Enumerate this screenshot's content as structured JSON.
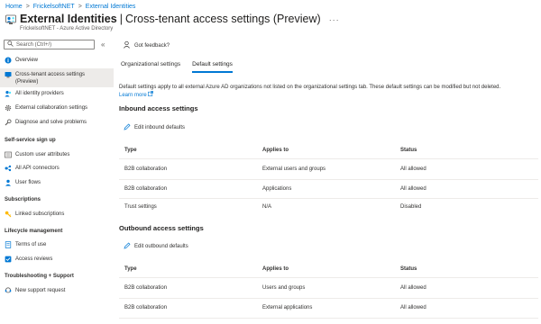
{
  "breadcrumb": {
    "items": [
      "Home",
      "FrickelsoftNET",
      "External Identities"
    ],
    "separator": ">"
  },
  "header": {
    "title": "External Identities",
    "separator": "|",
    "page": "Cross-tenant access settings (Preview)",
    "subtitle": "FrickelsoftNET - Azure Active Directory",
    "more": "···"
  },
  "sidebar": {
    "search_placeholder": "Search (Ctrl+/)",
    "collapse": "«",
    "items": [
      {
        "label": "Overview",
        "icon": "overview-icon"
      },
      {
        "label": "Cross-tenant access settings (Preview)",
        "icon": "cross-tenant-icon"
      },
      {
        "label": "All identity providers",
        "icon": "identity-providers-icon"
      },
      {
        "label": "External collaboration settings",
        "icon": "gear-icon"
      },
      {
        "label": "Diagnose and solve problems",
        "icon": "wrench-icon"
      },
      {
        "label": "Custom user attributes",
        "icon": "user-attributes-icon"
      },
      {
        "label": "All API connectors",
        "icon": "api-connectors-icon"
      },
      {
        "label": "User flows",
        "icon": "user-flows-icon"
      },
      {
        "label": "Linked subscriptions",
        "icon": "key-icon"
      },
      {
        "label": "Terms of use",
        "icon": "terms-icon"
      },
      {
        "label": "Access reviews",
        "icon": "access-reviews-icon"
      },
      {
        "label": "New support request",
        "icon": "support-icon"
      }
    ],
    "sections": [
      "Self-service sign up",
      "Subscriptions",
      "Lifecycle management",
      "Troubleshooting + Support"
    ]
  },
  "main": {
    "feedback": "Got feedback?",
    "tabs": [
      "Organizational settings",
      "Default settings"
    ],
    "active_tab": "Default settings",
    "description": "Default settings apply to all external Azure AD organizations not listed on the organizational settings tab. These default settings can be modified but not deleted.",
    "learn_more": "Learn more",
    "inbound": {
      "title": "Inbound access settings",
      "edit": "Edit inbound defaults",
      "headers": [
        "Type",
        "Applies to",
        "Status"
      ],
      "rows": [
        [
          "B2B collaboration",
          "External users and groups",
          "All allowed"
        ],
        [
          "B2B collaboration",
          "Applications",
          "All allowed"
        ],
        [
          "Trust settings",
          "N/A",
          "Disabled"
        ]
      ]
    },
    "outbound": {
      "title": "Outbound access settings",
      "edit": "Edit outbound defaults",
      "headers": [
        "Type",
        "Applies to",
        "Status"
      ],
      "rows": [
        [
          "B2B collaboration",
          "Users and groups",
          "All allowed"
        ],
        [
          "B2B collaboration",
          "External applications",
          "All allowed"
        ]
      ]
    }
  },
  "colors": {
    "accent": "#0078d4",
    "active_bg": "#edebe9",
    "text": "#323130"
  }
}
